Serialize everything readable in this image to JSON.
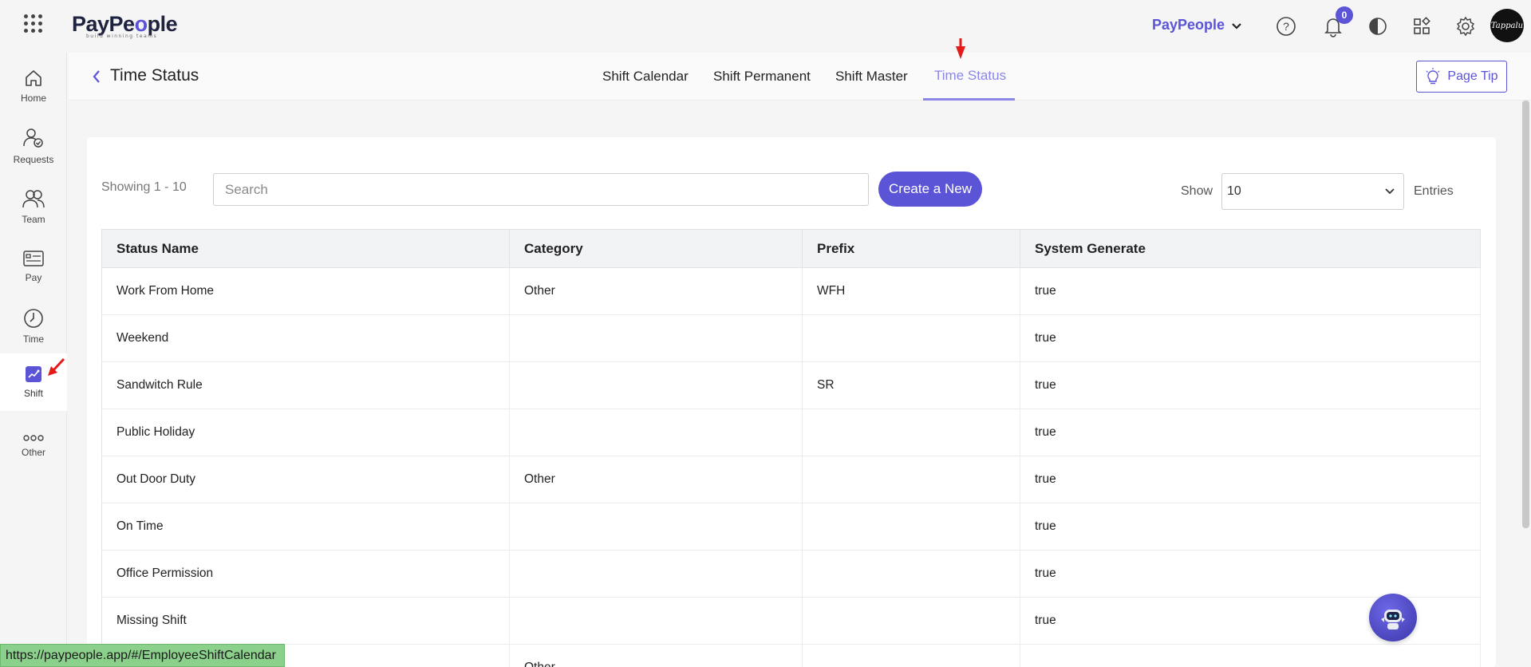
{
  "app": {
    "logo_text_a": "PayPe",
    "logo_text_b": "o",
    "logo_text_c": "ple",
    "logo_tagline": "build winning teams",
    "org_name": "PayPeople",
    "notification_count": "0",
    "avatar_text": "Tappalu",
    "accent_color": "#5b54d6"
  },
  "sidebar": {
    "items": [
      {
        "label": "Home",
        "icon": "home-icon"
      },
      {
        "label": "Requests",
        "icon": "requests-icon"
      },
      {
        "label": "Team",
        "icon": "team-icon"
      },
      {
        "label": "Pay",
        "icon": "pay-icon"
      },
      {
        "label": "Time",
        "icon": "clock-icon"
      },
      {
        "label": "Shift",
        "icon": "shift-icon",
        "active": true
      },
      {
        "label": "Other",
        "icon": "more-icon"
      }
    ]
  },
  "header": {
    "title": "Time Status",
    "tabs": [
      {
        "label": "Shift Calendar"
      },
      {
        "label": "Shift Permanent"
      },
      {
        "label": "Shift Master"
      },
      {
        "label": "Time Status",
        "active": true
      }
    ],
    "page_tip_label": "Page Tip"
  },
  "toolbar": {
    "showing_text": "Showing 1 - 10",
    "search_placeholder": "Search",
    "create_label": "Create a New",
    "show_label": "Show",
    "entries_value": "10",
    "entries_label": "Entries"
  },
  "table": {
    "columns": [
      "Status Name",
      "Category",
      "Prefix",
      "System Generate"
    ],
    "rows": [
      [
        "Work From Home",
        "Other",
        "WFH",
        "true"
      ],
      [
        "Weekend",
        "",
        "",
        "true"
      ],
      [
        "Sandwitch Rule",
        "",
        "SR",
        "true"
      ],
      [
        "Public Holiday",
        "",
        "",
        "true"
      ],
      [
        "Out Door Duty",
        "Other",
        "",
        "true"
      ],
      [
        "On Time",
        "",
        "",
        "true"
      ],
      [
        "Office Permission",
        "",
        "",
        "true"
      ],
      [
        "Missing Shift",
        "",
        "",
        "true"
      ],
      [
        "",
        "Other",
        "",
        ""
      ]
    ]
  },
  "status_bar": {
    "url": "https://paypeople.app/#/EmployeeShiftCalendar"
  }
}
